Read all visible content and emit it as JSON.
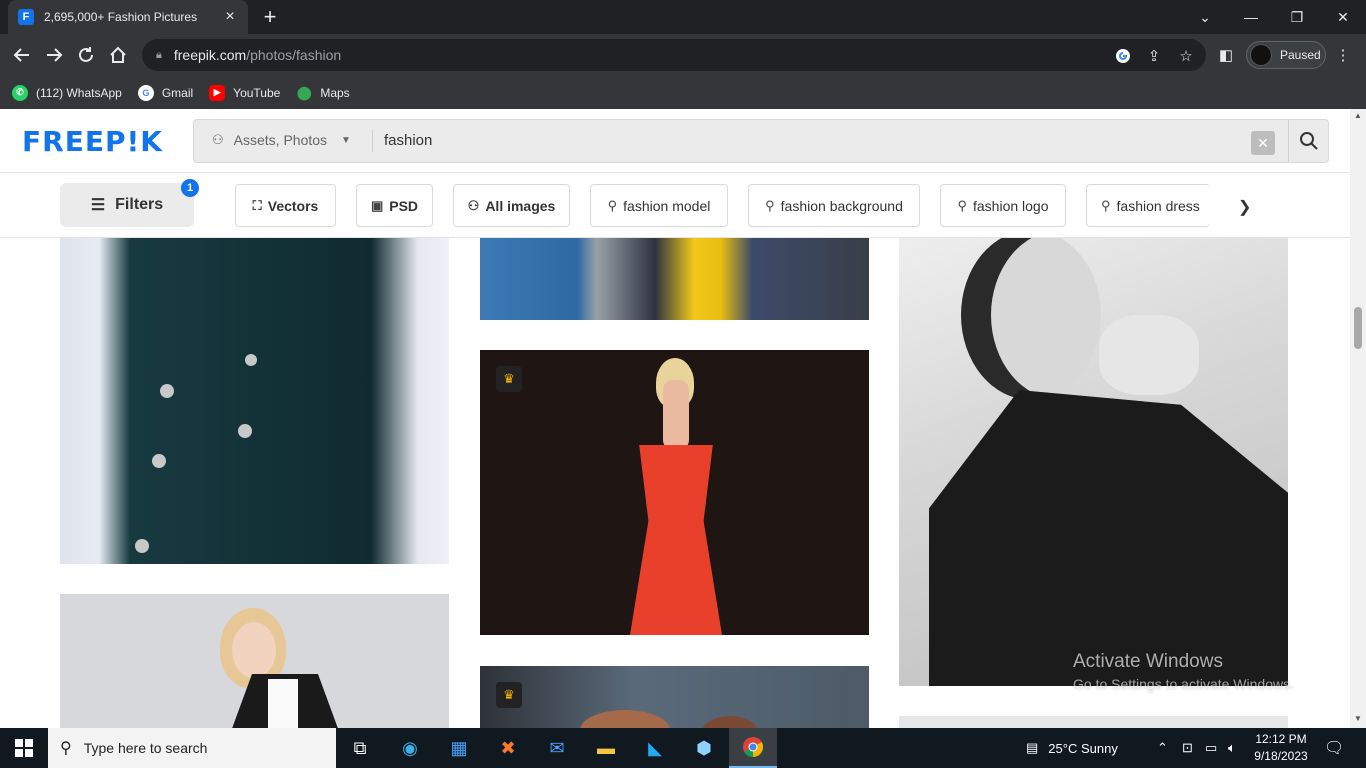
{
  "browser": {
    "tab_title": "2,695,000+ Fashion Pictures",
    "tab_favicon": "F",
    "new_tab": "+",
    "url_host": "freepik.com",
    "url_path": "/photos/fashion",
    "profile_label": "Paused",
    "window_controls": {
      "dropdown": "⌄",
      "minimize": "—",
      "restore": "❐",
      "close": "✕"
    },
    "bookmarks": [
      {
        "label": "(112) WhatsApp",
        "icon": "whatsapp-icon",
        "color": "#25d366"
      },
      {
        "label": "Gmail",
        "icon": "google-icon",
        "color": "#ffffff"
      },
      {
        "label": "YouTube",
        "icon": "youtube-icon",
        "color": "#ff0000"
      },
      {
        "label": "Maps",
        "icon": "maps-icon",
        "color": "#34a853"
      }
    ]
  },
  "site": {
    "logo": "FREEP!K",
    "brand_color": "#1273eb",
    "search_scope": "Assets, Photos",
    "search_query": "fashion",
    "filters_label": "Filters",
    "filters_count": "1",
    "chips": [
      {
        "label": "Vectors",
        "icon": "⛶"
      },
      {
        "label": "PSD",
        "icon": "▣"
      },
      {
        "label": "All images",
        "icon": "⚇"
      },
      {
        "label": "fashion model",
        "icon": "⚲"
      },
      {
        "label": "fashion background",
        "icon": "⚲"
      },
      {
        "label": "fashion logo",
        "icon": "⚲"
      },
      {
        "label": "fashion dress",
        "icon": "⚲"
      }
    ],
    "premium_icon": "♛"
  },
  "watermark": {
    "line1": "Activate Windows",
    "line2": "Go to Settings to activate Windows."
  },
  "taskbar": {
    "search_placeholder": "Type here to search",
    "weather": "25°C  Sunny",
    "time": "12:12 PM",
    "date": "9/18/2023"
  }
}
